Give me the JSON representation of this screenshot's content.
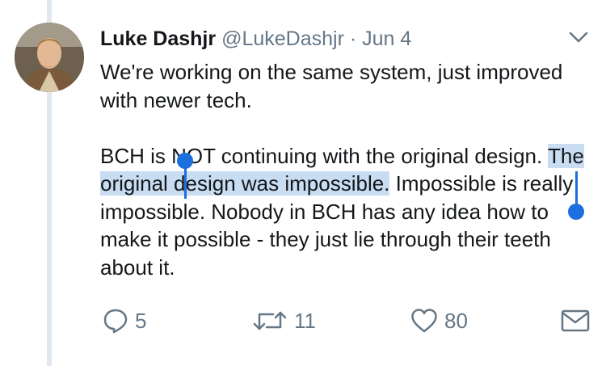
{
  "tweet": {
    "author_name": "Luke Dashjr",
    "handle": "@LukeDashjr",
    "separator": "·",
    "date": "Jun 4",
    "paragraph1": "We're working on the same system, just improved with newer tech.",
    "p2_before": "BCH is NOT continuing with the original design. ",
    "p2_selected": "The original design was impossible.",
    "p2_after": " Impossible is really impossible. Nobody in BCH has any idea how to make it possible - they just lie through their teeth about it."
  },
  "actions": {
    "reply_count": "5",
    "retweet_count": "11",
    "like_count": "80"
  },
  "icons": {
    "menu": "chevron-down-icon",
    "reply": "reply-bubble-icon",
    "retweet": "retweet-icon",
    "like": "heart-icon",
    "share": "envelope-icon"
  },
  "colors": {
    "selection_highlight": "#c9ddf2",
    "selection_handle": "#1d6fe0",
    "secondary_text": "#657786"
  }
}
